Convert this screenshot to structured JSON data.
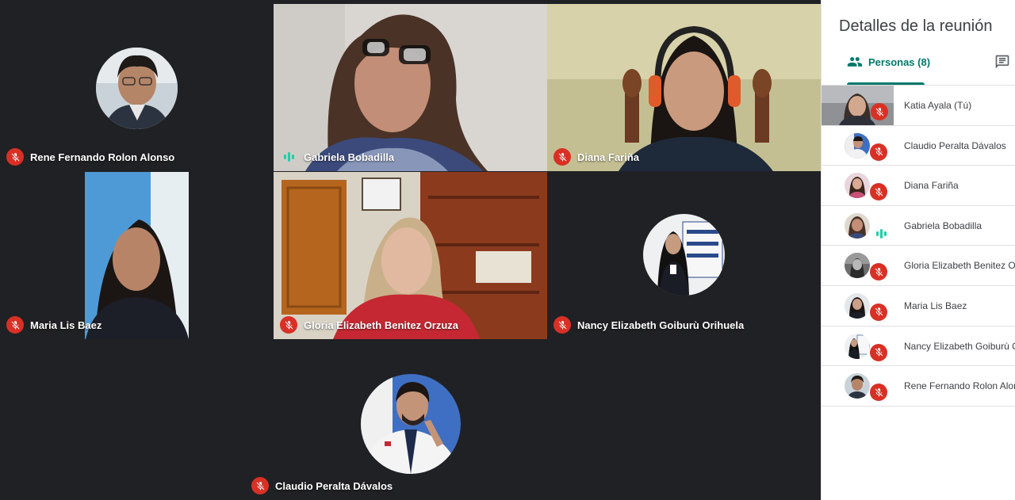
{
  "tiles": [
    {
      "name": "Rene Fernando Rolon Alonso",
      "mic": "off"
    },
    {
      "name": "Gabriela Bobadilla",
      "mic": "speaking"
    },
    {
      "name": "Diana Fariña",
      "mic": "off"
    },
    {
      "name": "Maria Lis Baez",
      "mic": "off"
    },
    {
      "name": "Gloria Elizabeth Benitez Orzuza",
      "mic": "off"
    },
    {
      "name": "Nancy Elizabeth Goiburù Orihuela",
      "mic": "off"
    },
    {
      "name": "Claudio Peralta Dávalos",
      "mic": "off"
    }
  ],
  "panel": {
    "title": "Detalles de la reunión",
    "tabs": {
      "people": "Personas (8)",
      "chat_icon": "chat-icon"
    },
    "people": [
      {
        "name": "Katia Ayala (Tú)",
        "mic": "off"
      },
      {
        "name": "Claudio Peralta Dávalos",
        "mic": "off"
      },
      {
        "name": "Diana Fariña",
        "mic": "off"
      },
      {
        "name": "Gabriela Bobadilla",
        "mic": "speaking"
      },
      {
        "name": "Gloria Elizabeth Benitez Orzuza",
        "mic": "off"
      },
      {
        "name": "Maria Lis Baez",
        "mic": "off"
      },
      {
        "name": "Nancy Elizabeth Goiburù Orihuela",
        "mic": "off"
      },
      {
        "name": "Rene Fernando Rolon Alonso",
        "mic": "off"
      }
    ]
  },
  "colors": {
    "mic_off": "#d93025",
    "speaking": "#1fcfa5",
    "accent": "#00796b",
    "tile_bg": "#202124"
  }
}
